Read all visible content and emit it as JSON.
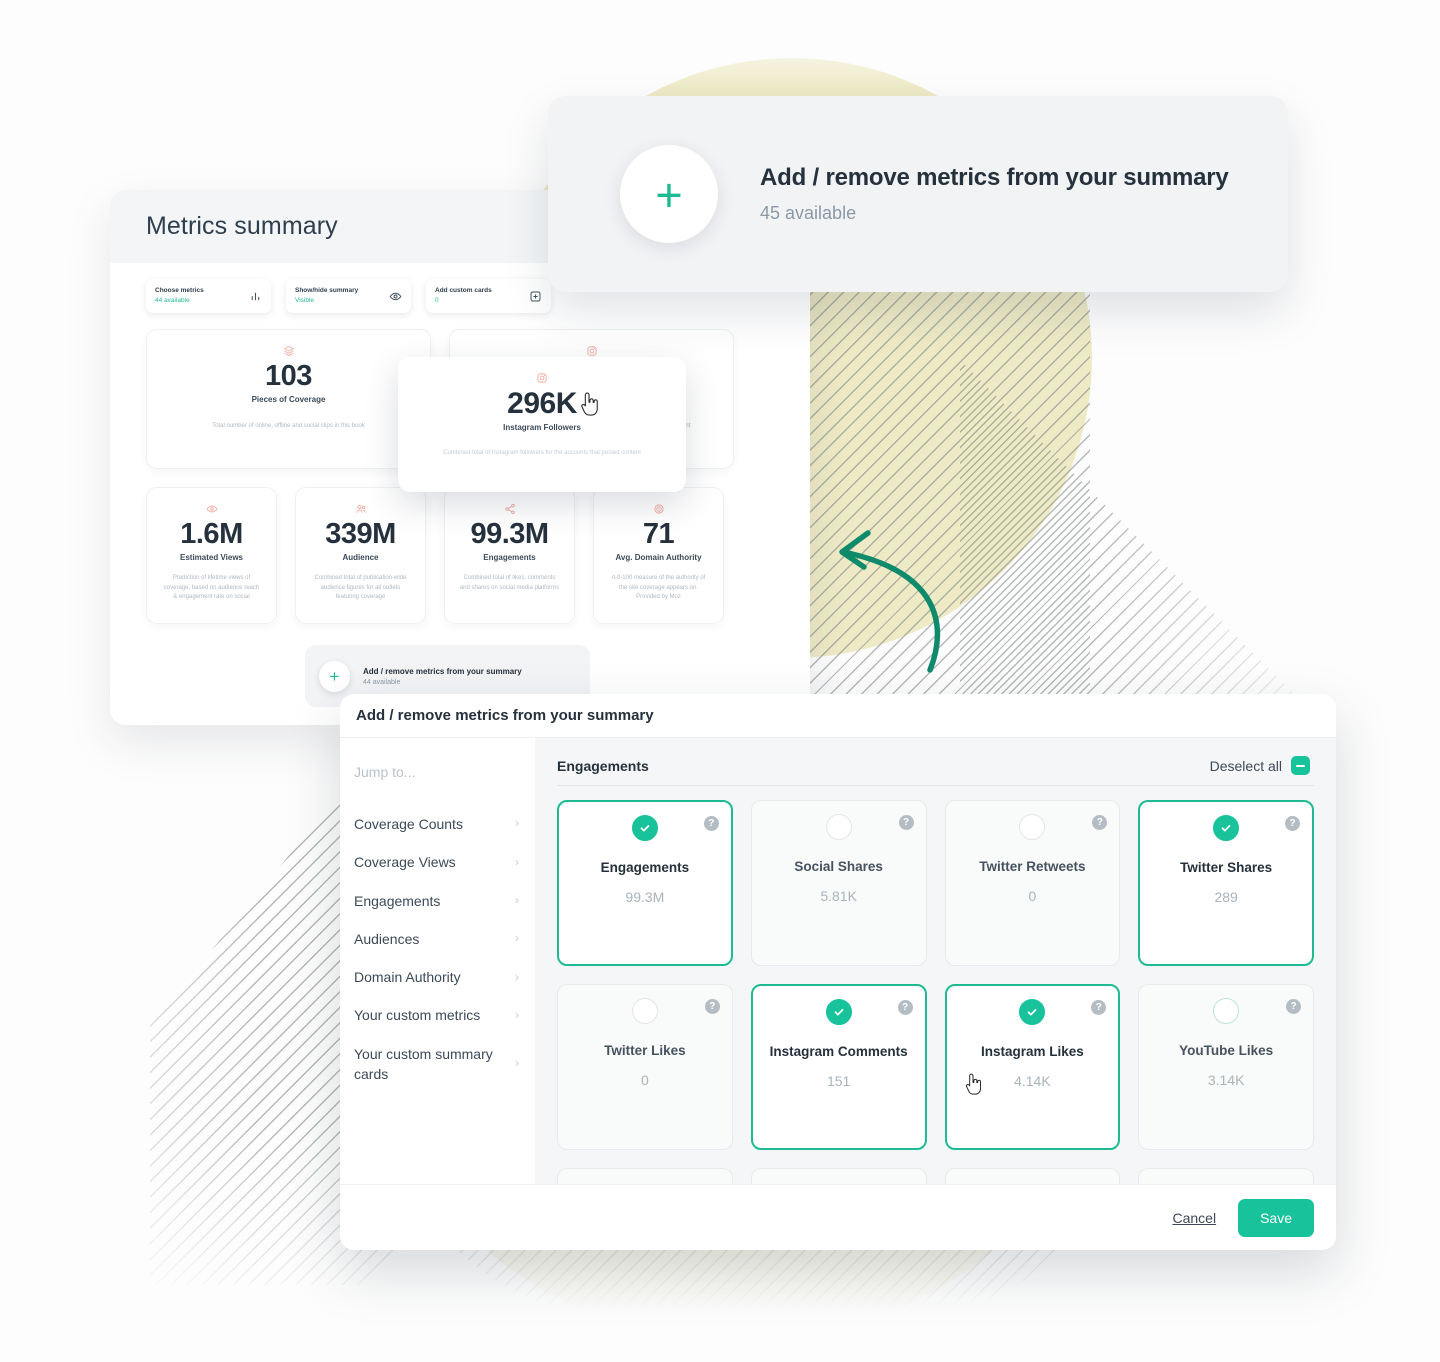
{
  "summary_panel": {
    "title": "Metrics summary",
    "chips": [
      {
        "label": "Choose metrics",
        "value": "44 available",
        "icon": "bar-chart-icon"
      },
      {
        "label": "Show/hide summary",
        "value": "Visible",
        "icon": "eye-icon"
      },
      {
        "label": "Add custom cards",
        "value": "0",
        "icon": "add-square-icon"
      }
    ],
    "row_a": [
      {
        "value": "103",
        "label": "Pieces of Coverage",
        "description": "Total number of online, offline and social clips in this book",
        "icon": "layers-icon"
      },
      {
        "value": "296K",
        "label": "Instagram Followers",
        "description": "Combined total of Instagram followers for the accounts that posted content",
        "icon": "instagram-icon"
      }
    ],
    "row_b": [
      {
        "value": "1.6M",
        "label": "Estimated Views",
        "description": "Prediction of lifetime views of coverage, based on audience reach & engagement rate on social",
        "icon": "eye-icon"
      },
      {
        "value": "339M",
        "label": "Audience",
        "description": "Combined total of publication-wide audience figures for all outlets featuring coverage",
        "icon": "people-icon"
      },
      {
        "value": "99.3M",
        "label": "Engagements",
        "description": "Combined total of likes, comments and shares on social media platforms",
        "icon": "share-icon"
      },
      {
        "value": "71",
        "label": "Avg. Domain Authority",
        "description": "A 0-100 measure of the authority of the site coverage appears on. Provided by Moz",
        "icon": "target-icon"
      }
    ],
    "add_strip": {
      "title": "Add / remove metrics from your summary",
      "subtitle": "44 available",
      "icon": "plus-icon"
    },
    "hover_card": {
      "value": "296K",
      "label": "Instagram Followers",
      "description": "Combined total of Instagram followers for the accounts that posted content",
      "icon": "instagram-icon"
    }
  },
  "toast": {
    "title": "Add / remove metrics from your summary",
    "subtitle": "45 available",
    "icon": "plus-icon"
  },
  "modal": {
    "title": "Add / remove metrics from your summary",
    "sidebar": {
      "jump_label": "Jump to...",
      "items": [
        {
          "label": "Coverage Counts",
          "chevron": "chevron-right-icon"
        },
        {
          "label": "Coverage Views",
          "chevron": "chevron-right-icon"
        },
        {
          "label": "Engagements",
          "chevron": "chevron-right-icon"
        },
        {
          "label": "Audiences",
          "chevron": "chevron-right-icon"
        },
        {
          "label": "Domain Authority",
          "chevron": "chevron-right-icon"
        },
        {
          "label": "Your custom metrics",
          "chevron": "chevron-right-icon"
        },
        {
          "label": "Your custom summary cards",
          "chevron": "chevron-right-icon"
        }
      ]
    },
    "section": {
      "heading": "Engagements",
      "deselect_label": "Deselect all"
    },
    "cards": [
      {
        "name": "Engagements",
        "value": "99.3M",
        "selected": true,
        "hovered": false
      },
      {
        "name": "Social Shares",
        "value": "5.81K",
        "selected": false,
        "hovered": false
      },
      {
        "name": "Twitter Retweets",
        "value": "0",
        "selected": false,
        "hovered": false
      },
      {
        "name": "Twitter Shares",
        "value": "289",
        "selected": true,
        "hovered": false
      },
      {
        "name": "Twitter Likes",
        "value": "0",
        "selected": false,
        "hovered": false
      },
      {
        "name": "Instagram Comments",
        "value": "151",
        "selected": true,
        "hovered": false
      },
      {
        "name": "Instagram Likes",
        "value": "4.14K",
        "selected": true,
        "hovered": false
      },
      {
        "name": "YouTube Likes",
        "value": "3.14K",
        "selected": false,
        "hovered": true
      }
    ],
    "help_glyph": "?",
    "footer": {
      "cancel_label": "Cancel",
      "save_label": "Save"
    }
  },
  "colors": {
    "accent_green": "#18c29a",
    "arrow_green": "#0f8a6a",
    "background_yellow": "#eeeac6",
    "text_dark": "#25313d",
    "text_muted": "#a9b3bb",
    "icon_coral": "#f1a9a0"
  }
}
